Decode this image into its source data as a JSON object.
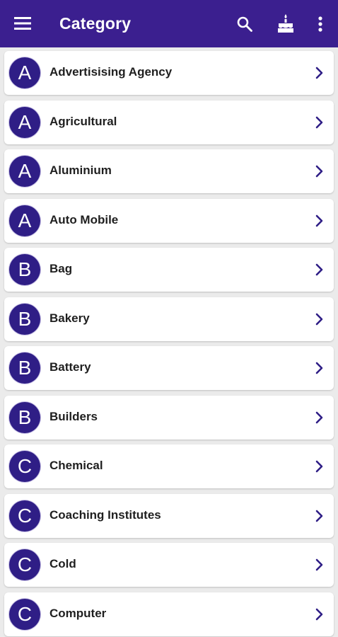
{
  "header": {
    "title": "Category",
    "icons": [
      "menu-icon",
      "search-icon",
      "cake-icon",
      "more-vert-icon"
    ],
    "color": "#3b1f8f"
  },
  "categories": [
    {
      "initial": "A",
      "name": "Advertisising Agency"
    },
    {
      "initial": "A",
      "name": "Agricultural"
    },
    {
      "initial": "A",
      "name": "Aluminium"
    },
    {
      "initial": "A",
      "name": "Auto Mobile"
    },
    {
      "initial": "B",
      "name": "Bag"
    },
    {
      "initial": "B",
      "name": "Bakery"
    },
    {
      "initial": "B",
      "name": "Battery"
    },
    {
      "initial": "B",
      "name": "Builders"
    },
    {
      "initial": "C",
      "name": "Chemical"
    },
    {
      "initial": "C",
      "name": "Coaching Institutes"
    },
    {
      "initial": "C",
      "name": "Cold"
    },
    {
      "initial": "C",
      "name": "Computer"
    }
  ],
  "colors": {
    "avatar": "#2f1e86",
    "chevron": "#2f1e86",
    "background": "#ebebeb"
  }
}
